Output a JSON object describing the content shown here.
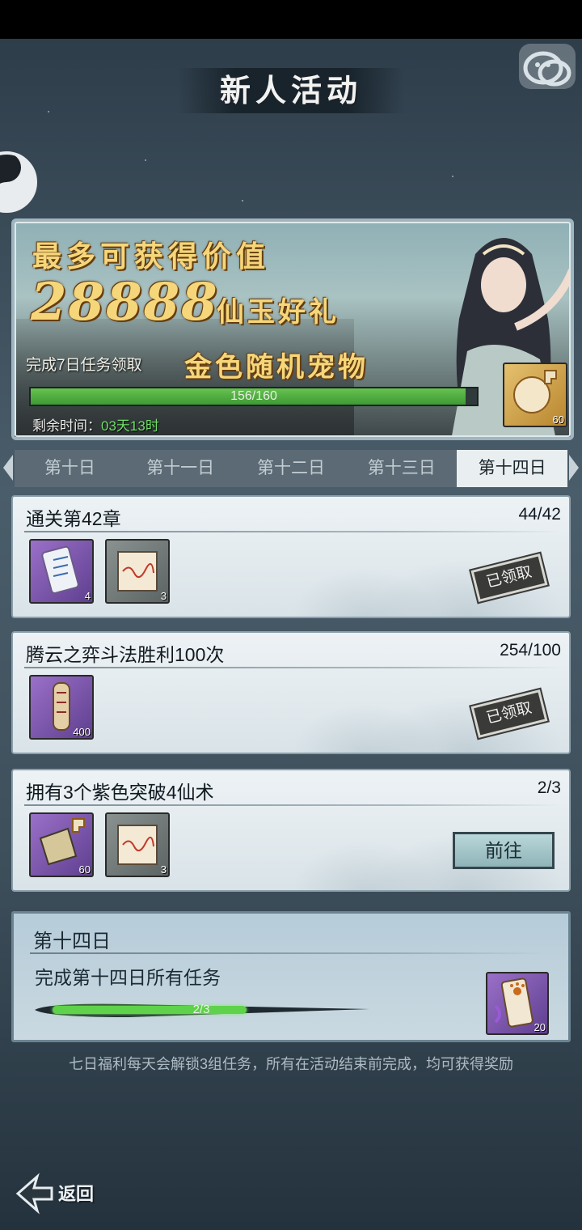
{
  "header": {
    "title": "新人活动"
  },
  "banner": {
    "line1": "最多可获得价值",
    "value": "28888",
    "gift": "仙玉好礼",
    "task_text": "完成7日任务领取",
    "pet_text": "金色随机宠物",
    "progress": {
      "label": "156/160",
      "current": 156,
      "total": 160
    },
    "remain_label": "剩余时间：",
    "remain_value": "03天13时",
    "reward_count": "60"
  },
  "tabs": [
    "第十日",
    "第十一日",
    "第十二日",
    "第十三日",
    "第十四日"
  ],
  "active_tab": "第十四日",
  "tasks": [
    {
      "title": "通关第42章",
      "count": "44/42",
      "rewards": [
        {
          "count": "4"
        },
        {
          "count": "3"
        }
      ],
      "status": "已领取"
    },
    {
      "title": "腾云之弈斗法胜利100次",
      "count": "254/100",
      "rewards": [
        {
          "count": "400"
        }
      ],
      "status": "已领取"
    },
    {
      "title": "拥有3个紫色突破4仙术",
      "count": "2/3",
      "rewards": [
        {
          "count": "60"
        },
        {
          "count": "3"
        }
      ],
      "action": "前往"
    }
  ],
  "day_summary": {
    "title": "第十四日",
    "desc": "完成第十四日所有任务",
    "progress_label": "2/3",
    "progress_fraction": 0.667,
    "reward_count": "20"
  },
  "note": "七日福利每天会解锁3组任务，所有在活动结束前完成，均可获得奖励",
  "footer": {
    "back_label": "返回"
  },
  "icons": {
    "wechat": "wechat-icon",
    "yinyang": "yinyang-icon",
    "back": "back-arrow-icon"
  }
}
